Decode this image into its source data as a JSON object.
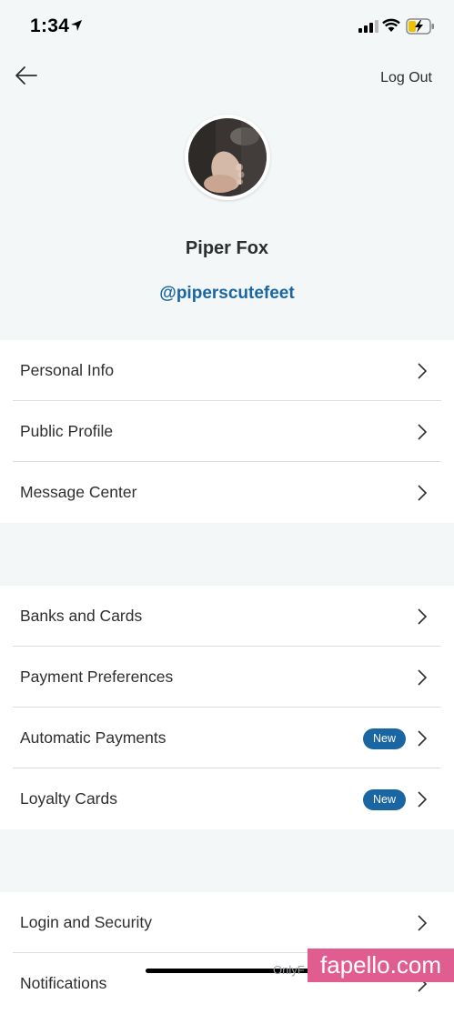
{
  "status_bar": {
    "time": "1:34"
  },
  "header": {
    "logout_label": "Log Out"
  },
  "profile": {
    "name": "Piper Fox",
    "handle": "@piperscutefeet"
  },
  "groups": [
    {
      "items": [
        {
          "label": "Personal Info"
        },
        {
          "label": "Public Profile"
        },
        {
          "label": "Message Center"
        }
      ]
    },
    {
      "items": [
        {
          "label": "Banks and Cards"
        },
        {
          "label": "Payment Preferences"
        },
        {
          "label": "Automatic Payments",
          "badge": "New"
        },
        {
          "label": "Loyalty Cards",
          "badge": "New"
        }
      ]
    },
    {
      "items": [
        {
          "label": "Login and Security"
        },
        {
          "label": "Notifications"
        }
      ]
    }
  ],
  "watermark": {
    "text": "OnlyF",
    "logo": "fapello.com"
  },
  "colors": {
    "accent": "#1a66a3",
    "background": "#f4f7f8",
    "watermark": "#e05d8f"
  }
}
